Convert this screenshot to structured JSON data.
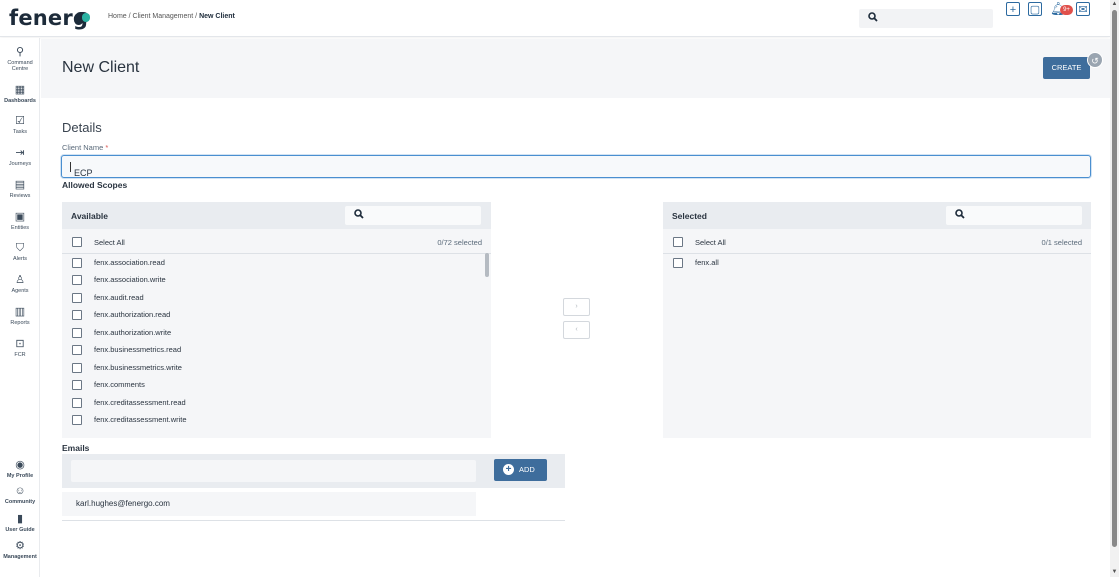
{
  "header": {
    "logo_text": "fenerg",
    "breadcrumb_home": "Home",
    "breadcrumb_sep1": " / ",
    "breadcrumb_section": "Client Management",
    "breadcrumb_sep2": " / ",
    "breadcrumb_current": "New Client",
    "search_placeholder": "",
    "notification_count": "9+"
  },
  "sidebar": {
    "items": [
      {
        "label": "Command",
        "label2": "Centre",
        "icon": "rocket-icon"
      },
      {
        "label": "Dashboards",
        "icon": "dashboard-icon"
      },
      {
        "label": "Tasks",
        "icon": "tasks-icon"
      },
      {
        "label": "Journeys",
        "icon": "journeys-icon"
      },
      {
        "label": "Reviews",
        "icon": "reviews-icon"
      },
      {
        "label": "Entities",
        "icon": "entities-icon"
      },
      {
        "label": "Alerts",
        "icon": "alerts-icon"
      },
      {
        "label": "Agents",
        "icon": "agents-icon"
      },
      {
        "label": "Reports",
        "icon": "reports-icon"
      },
      {
        "label": "FCR",
        "icon": "fcr-icon"
      }
    ],
    "bottom_items": [
      {
        "label": "My Profile",
        "icon": "profile-icon"
      },
      {
        "label": "Community",
        "icon": "community-icon"
      },
      {
        "label": "User Guide",
        "icon": "user-guide-icon"
      },
      {
        "label": "Management",
        "icon": "management-icon"
      }
    ]
  },
  "page": {
    "title": "New Client",
    "create_label": "CREATE",
    "details_title": "Details",
    "client_name_label": "Client Name",
    "required_mark": "*",
    "client_name_value": "ECP",
    "allowed_scopes_label": "Allowed Scopes"
  },
  "available": {
    "title": "Available",
    "select_all_label": "Select All",
    "count": "0/72 selected",
    "items": [
      "fenx.association.read",
      "fenx.association.write",
      "fenx.audit.read",
      "fenx.authorization.read",
      "fenx.authorization.write",
      "fenx.businessmetrics.read",
      "fenx.businessmetrics.write",
      "fenx.comments",
      "fenx.creditassessment.read",
      "fenx.creditassessment.write"
    ]
  },
  "selected": {
    "title": "Selected",
    "select_all_label": "Select All",
    "count": "0/1 selected",
    "items": [
      "fenx.all"
    ]
  },
  "transfer": {
    "move_right": "›",
    "move_left": "‹"
  },
  "emails": {
    "label": "Emails",
    "input_value": "",
    "add_label": "ADD",
    "items": [
      "karl.hughes@fenergo.com"
    ]
  },
  "colors": {
    "primary": "#3e6d9c",
    "brand_teal": "#2bb3a3",
    "badge_red": "#e0504b",
    "panel_bg": "#f5f6f8",
    "panel_head": "#e9ecf0"
  }
}
